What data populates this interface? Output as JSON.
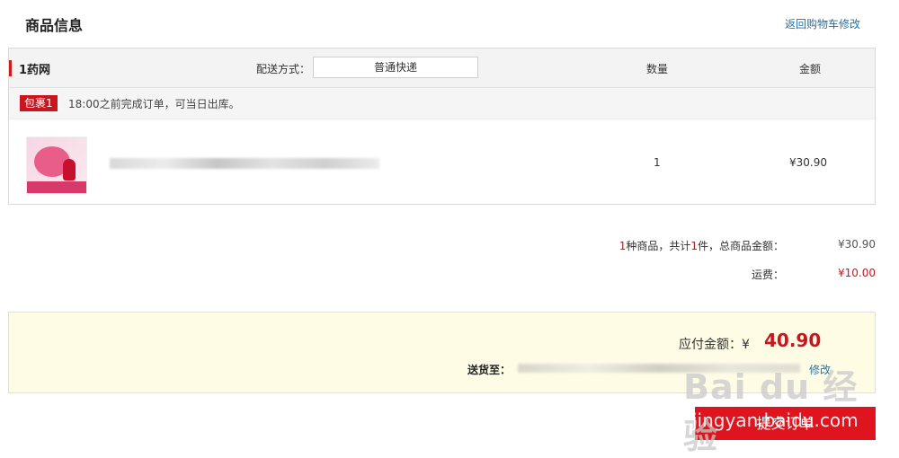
{
  "header": {
    "title": "商品信息",
    "back_link": "返回购物车修改"
  },
  "order": {
    "store_name": "1药网",
    "shipping_label": "配送方式：",
    "shipping_value": "普通快递",
    "qty_header": "数量",
    "amount_header": "金额",
    "package_badge": "包裹1",
    "package_note": "18:00之前完成订单，可当日出库。",
    "item": {
      "qty": "1",
      "price": "¥30.90"
    }
  },
  "summary": {
    "count_num": "1",
    "count_mid": "种商品，共计",
    "count_num2": "1",
    "count_tail": "件，总商品金额：",
    "total": "¥30.90",
    "freight_label": "运费：",
    "freight_value": "¥10.00"
  },
  "pay": {
    "label": "应付金额：¥",
    "amount": "40.90",
    "ship_to_label": "送货至：",
    "edit_link": "修改"
  },
  "submit": {
    "label": "提交订单"
  },
  "watermark": {
    "brand": "Bai du 经验",
    "url": "jingyan.baidu.com"
  },
  "colors": {
    "accent_red": "#c9151e",
    "link_blue": "#2a6f9c",
    "pay_bg": "#fffce6"
  }
}
